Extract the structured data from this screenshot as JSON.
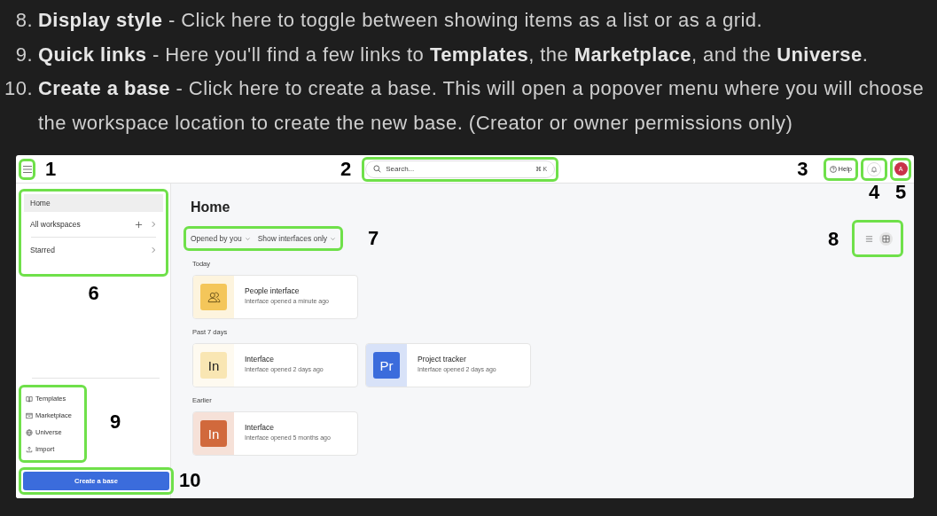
{
  "instructions": [
    {
      "number": "8.",
      "text": "**Display style** - Click here to toggle between showing items as a list or as a grid."
    },
    {
      "number": "9.",
      "text": "**Quick links** - Here you'll find a few links to **Templates**, the **Marketplace**, and the **Universe**."
    },
    {
      "number": "10.",
      "text": "**Create a base** - Click here to create a base. This will open a popover menu where you will choose the workspace location to create the new base. (Creator or owner permissions only)"
    }
  ],
  "screenshot": {
    "topbar": {
      "menu_callout": "1",
      "search": {
        "placeholder": "Search...",
        "shortcut": "⌘ K",
        "callout": "2"
      },
      "help": {
        "label": "Help",
        "callout": "3"
      },
      "notifications": {
        "callout": "4"
      },
      "avatar": {
        "initial": "A",
        "callout": "5"
      }
    },
    "sidebar": {
      "nav": [
        {
          "label": "Home",
          "selected": true,
          "kind": "link"
        },
        {
          "label": "All workspaces",
          "selected": false,
          "kind": "workspaces"
        },
        {
          "label": "Starred",
          "selected": false,
          "kind": "expandable"
        }
      ],
      "nav_callout": "6",
      "quick_links": [
        {
          "label": "Templates",
          "kind": "book"
        },
        {
          "label": "Marketplace",
          "kind": "store"
        },
        {
          "label": "Universe",
          "kind": "globe"
        },
        {
          "label": "Import",
          "kind": "upload"
        }
      ],
      "quick_links_callout": "9",
      "create_button": {
        "label": "Create a base",
        "callout": "10"
      }
    },
    "main": {
      "title": "Home",
      "filters": [
        {
          "label": "Opened by you"
        },
        {
          "label": "Show interfaces only"
        }
      ],
      "filters_callout": "7",
      "view_toggle": {
        "options": [
          {
            "kind": "list",
            "selected": false
          },
          {
            "kind": "grid",
            "selected": true
          }
        ],
        "callout": "8"
      },
      "sections": [
        {
          "label": "Today",
          "cards": [
            {
              "name": "People interface",
              "subtitle": "Interface opened a minute ago",
              "kind": "icon",
              "color": "#f4c65a"
            }
          ]
        },
        {
          "label": "Past 7 days",
          "cards": [
            {
              "name": "Interface",
              "subtitle": "Interface opened 2 days ago",
              "kind": "letters",
              "letters": "In",
              "color": "#f9e6b3"
            },
            {
              "name": "Project tracker",
              "subtitle": "Interface opened 2 days ago",
              "kind": "letters",
              "letters": "Pr",
              "color": "#3b6cdc"
            }
          ]
        },
        {
          "label": "Earlier",
          "cards": [
            {
              "name": "Interface",
              "subtitle": "Interface opened 5 months ago",
              "kind": "letters",
              "letters": "In",
              "color": "#d1693c"
            }
          ]
        }
      ]
    }
  }
}
